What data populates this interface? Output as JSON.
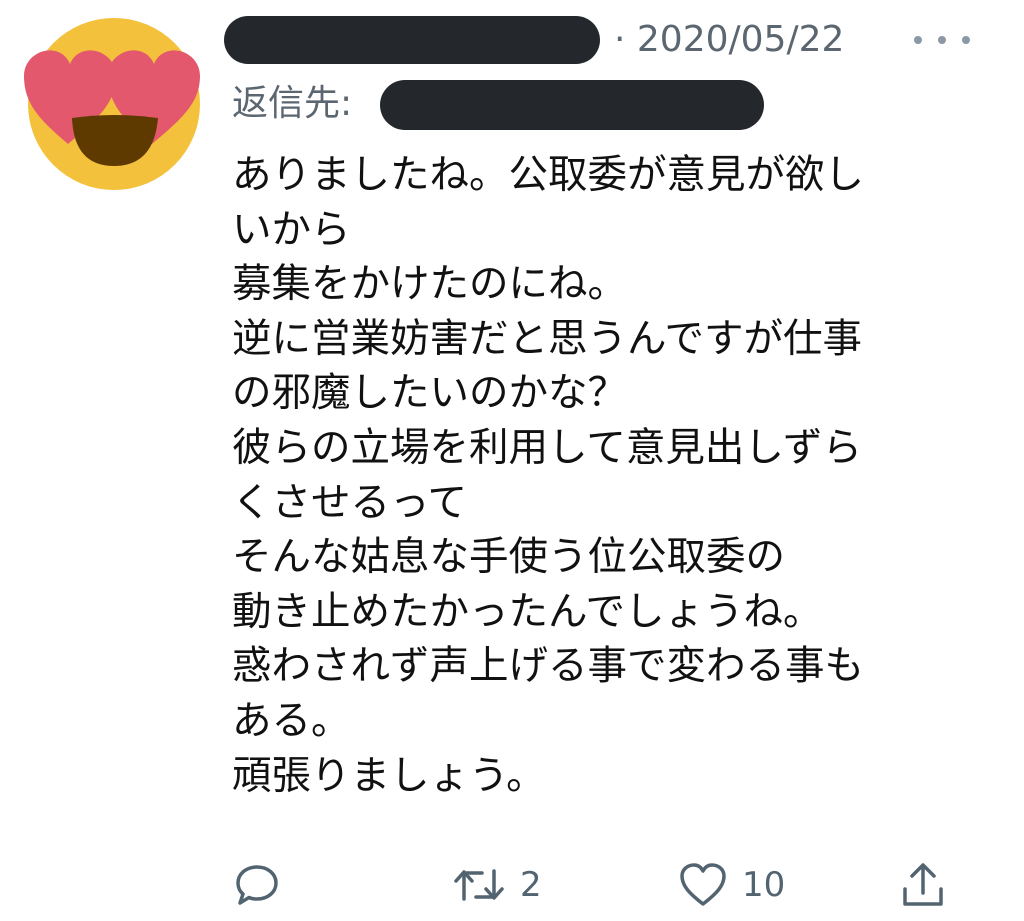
{
  "tweet": {
    "author": {
      "avatar_icon": "heart-eyes-emoji-icon",
      "name_redacted": true
    },
    "date": "· 2020/05/22",
    "more_icon": "more-horizontal-icon",
    "reply_to": {
      "label": "返信先:",
      "handle_redacted": true
    },
    "body_lines": [
      "ありましたね。公取委が意見が欲し",
      "いから",
      "募集をかけたのにね。",
      "逆に営業妨害だと思うんですが仕事",
      "の邪魔したいのかな？",
      "彼らの立場を利用して意見出しずら",
      "くさせるって",
      "そんな姑息な手使う位公取委の",
      "動き止めたかったんでしょうね。",
      "惑わされず声上げる事で変わる事も",
      "ある。",
      "頑張りましょう。"
    ],
    "actions": {
      "reply": {
        "icon": "reply-bubble-icon",
        "count": ""
      },
      "retweet": {
        "icon": "retweet-icon",
        "count": "2"
      },
      "like": {
        "icon": "heart-icon",
        "count": "10"
      },
      "share": {
        "icon": "share-upload-icon",
        "count": ""
      }
    }
  },
  "colors": {
    "text": "#111111",
    "muted": "#5b6670",
    "icon": "#536471",
    "redaction": "#24282c",
    "emoji_face": "#f4c13d",
    "emoji_heart": "#e3586c",
    "emoji_mouth": "#5e3a00"
  }
}
